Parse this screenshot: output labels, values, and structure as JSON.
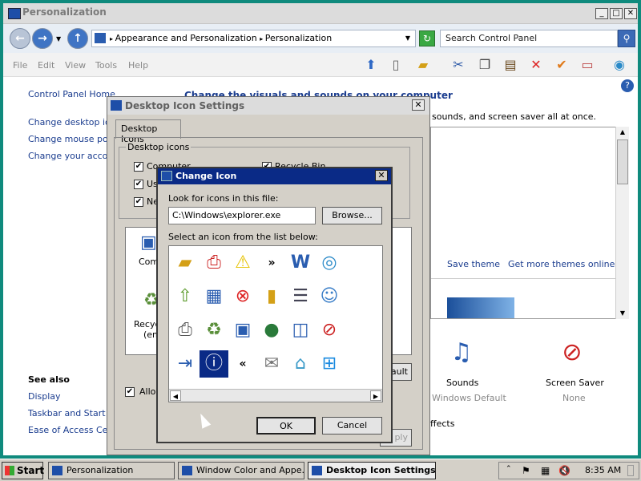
{
  "main_window": {
    "title": "Personalization",
    "breadcrumb_1": "Appearance and Personalization",
    "breadcrumb_2": "Personalization",
    "search_placeholder": "Search Control Panel",
    "menu": [
      "File",
      "Edit",
      "View",
      "Tools",
      "Help"
    ],
    "left_links": [
      "Control Panel Home",
      "Change desktop icon",
      "Change mouse point",
      "Change your accoun"
    ],
    "see_also_title": "See also",
    "see_also": [
      "Display",
      "Taskbar and Start M",
      "Ease of Access Cent"
    ],
    "heading": "Change the visuals and sounds on your computer",
    "subtext": "sounds, and screen saver all at once.",
    "save_theme": "Save theme",
    "more_themes": "Get more themes online",
    "sounds_label": "Sounds",
    "sounds_value": "Windows Default",
    "screensaver_label": "Screen Saver",
    "screensaver_value": "None",
    "effects_text": "ffects"
  },
  "desktop_icon_settings": {
    "title": "Desktop Icon Settings",
    "tab": "Desktop Icons",
    "group_label": "Desktop icons",
    "cb_computer": "Computer",
    "cb_user": "Us",
    "cb_network": "Ne",
    "cb_recycle": "Recycle Bin",
    "icon_computer": "Comp",
    "icon_recycle": "Recyc",
    "icon_recycle_2": "(em",
    "allow_label": "Allow",
    "default_btn": "ault",
    "apply_btn": "ply"
  },
  "change_icon": {
    "title": "Change Icon",
    "look_label": "Look for icons in this file:",
    "file_path": "C:\\Windows\\explorer.exe",
    "browse": "Browse...",
    "select_label": "Select an icon from the list below:",
    "ok": "OK",
    "cancel": "Cancel",
    "icons": [
      "folder-icon",
      "printer-help-icon",
      "warning-icon",
      "forward-arrows-icon",
      "word-document-icon",
      "internet-globe-icon",
      "folder-up-icon",
      "control-panel-icon",
      "error-x-icon",
      "folder-yellow-icon",
      "document-list-icon",
      "users-icon",
      "printer-icon",
      "recycle-bin-icon",
      "computer-icon",
      "globe-icon",
      "network-display-icon",
      "blocked-document-icon",
      "exit-icon",
      "info-icon",
      "back-arrows-icon",
      "mail-icon",
      "basket-icon",
      "windows-logo-icon"
    ]
  },
  "taskbar": {
    "start": "Start",
    "items": [
      "Personalization",
      "Window Color and Appe...",
      "Desktop Icon Settings"
    ],
    "clock": "8:35 AM"
  }
}
